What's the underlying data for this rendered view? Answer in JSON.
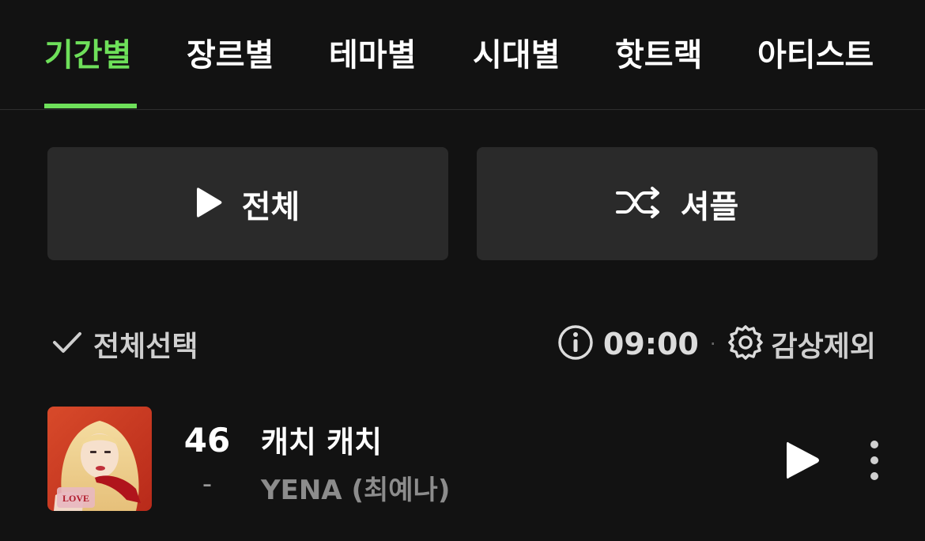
{
  "tabs": [
    {
      "label": "기간별",
      "active": true
    },
    {
      "label": "장르별"
    },
    {
      "label": "테마별"
    },
    {
      "label": "시대별"
    },
    {
      "label": "핫트랙"
    },
    {
      "label": "아티스트"
    }
  ],
  "actions": {
    "play_all_label": "전체",
    "shuffle_label": "셔플"
  },
  "toolbar": {
    "select_all_label": "전체선택",
    "time": "09:00",
    "separator": "·",
    "exclude_label": "감상제외"
  },
  "tracks": [
    {
      "rank": "46",
      "change": "-",
      "title": "캐치 캐치",
      "artist": "YENA (최예나)",
      "cover_text": "LOVE"
    }
  ],
  "colors": {
    "accent": "#6ee05a",
    "background": "#121212",
    "button_bg": "#2a2a2a"
  }
}
